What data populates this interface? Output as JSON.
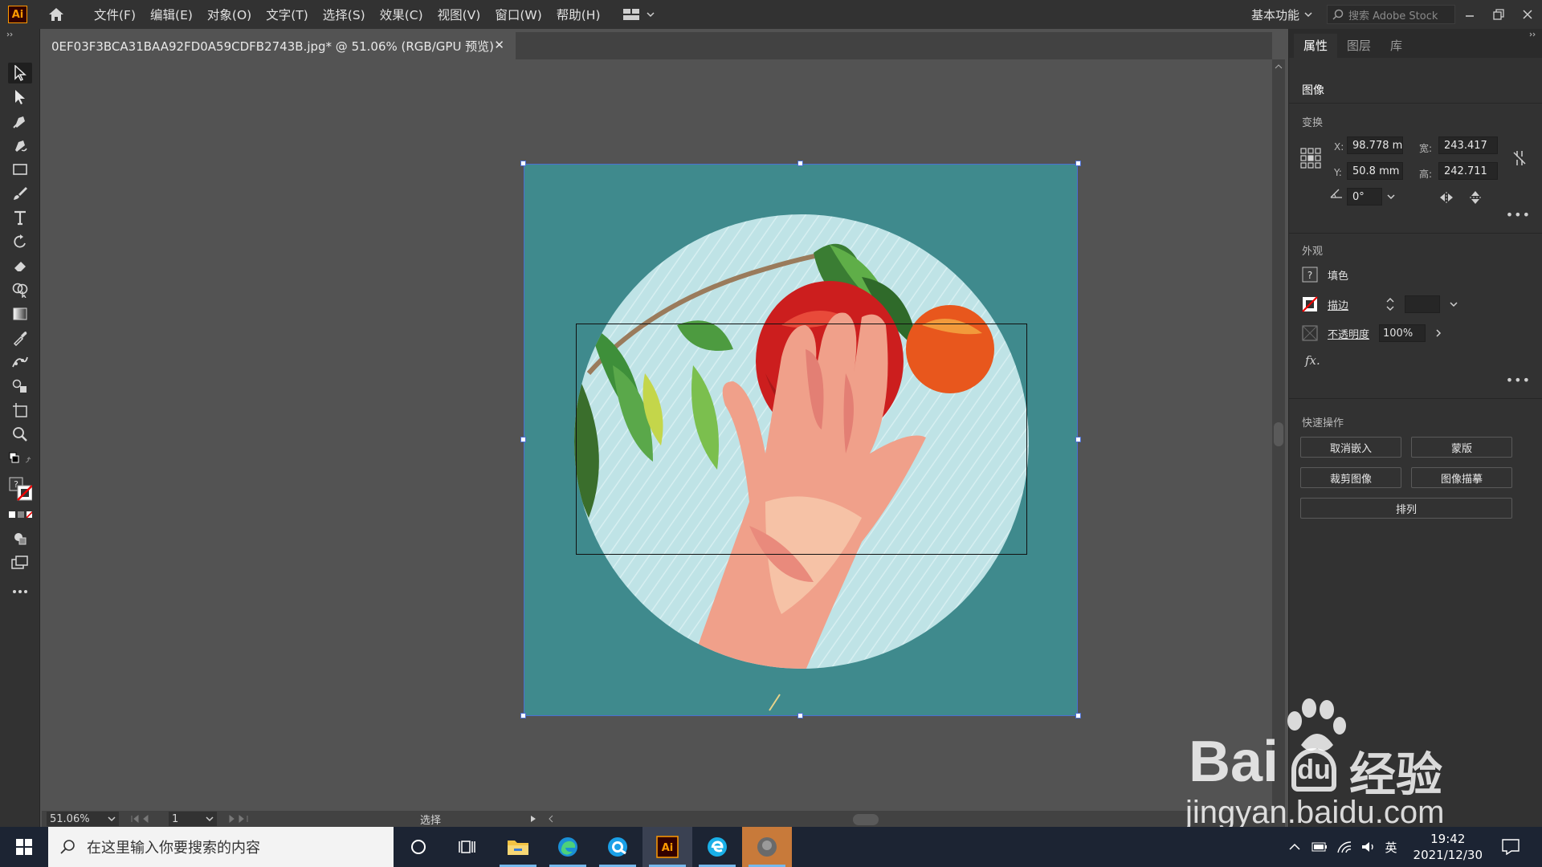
{
  "app": {
    "logo": "Ai",
    "menu": [
      "文件(F)",
      "编辑(E)",
      "对象(O)",
      "文字(T)",
      "选择(S)",
      "效果(C)",
      "视图(V)",
      "窗口(W)",
      "帮助(H)"
    ],
    "workspace": "基本功能",
    "stock_search_placeholder": "搜索 Adobe Stock"
  },
  "document": {
    "tab_title": "0EF03F3BCA31BAA92FD0A59CDFB2743B.jpg* @ 51.06% (RGB/GPU 预览)",
    "close_glyph": "✕"
  },
  "status": {
    "zoom": "51.06%",
    "page": "1",
    "tool": "选择"
  },
  "panel": {
    "tabs": [
      "属性",
      "图层",
      "库"
    ],
    "object_type": "图像",
    "transform": {
      "title": "变换",
      "x_label": "X:",
      "x": "98.778 mm",
      "y_label": "Y:",
      "y": "50.8 mm",
      "w_label": "宽:",
      "w": "243.417",
      "h_label": "高:",
      "h": "242.711",
      "angle": "0°"
    },
    "appearance": {
      "title": "外观",
      "fill_label": "填色",
      "stroke_label": "描边",
      "opacity_label": "不透明度",
      "opacity": "100%",
      "fx_label": "fx."
    },
    "quick_actions": {
      "title": "快速操作",
      "unembed": "取消嵌入",
      "mask": "蒙版",
      "crop": "裁剪图像",
      "trace": "图像描摹",
      "arrange": "排列"
    }
  },
  "watermark": {
    "brand_left": "Bai",
    "brand_right": "经验",
    "url": "jingyan.baidu.com"
  },
  "taskbar": {
    "search_placeholder": "在这里输入你要搜索的内容",
    "ime": "英",
    "time": "19:42",
    "date": "2021/12/30"
  },
  "colors": {
    "accent_orange": "#ff9a00",
    "selection_blue": "#4b6fd1",
    "teal_bg": "#3f8a8d",
    "circle_bg": "#bfe3e6"
  }
}
